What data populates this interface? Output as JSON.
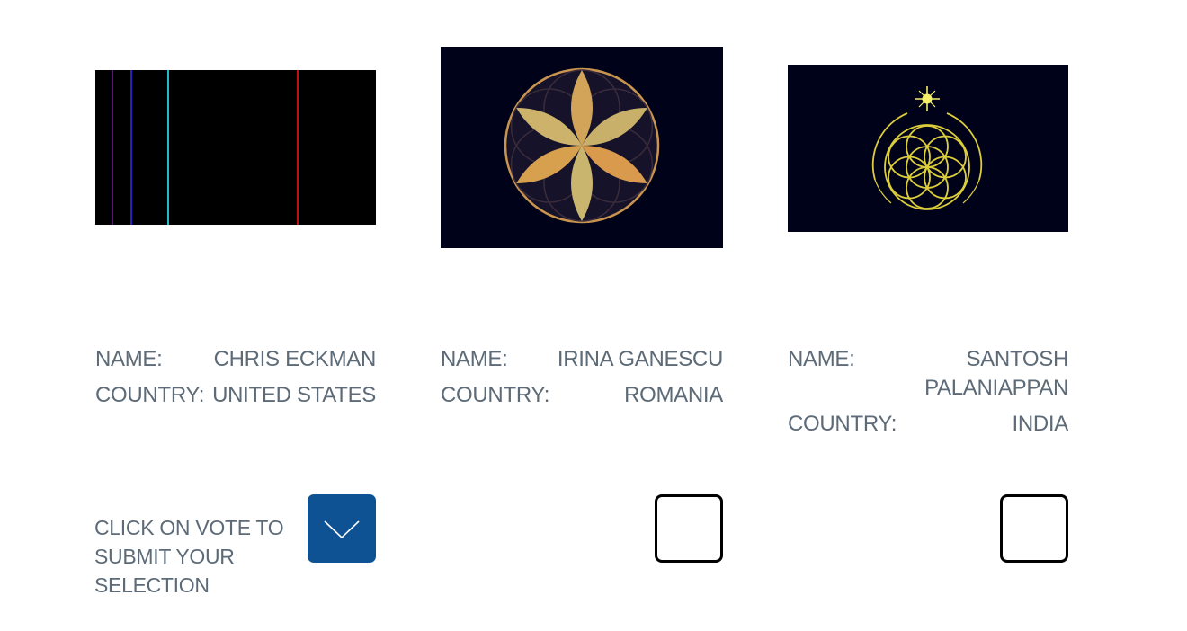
{
  "entries": [
    {
      "image_icon": "spectral-lines-image",
      "name_label": "NAME:",
      "name": "CHRIS ECKMAN",
      "country_label": "COUNTRY:",
      "country": "UNITED STATES",
      "selected": true
    },
    {
      "image_icon": "golden-flower-of-life-image",
      "name_label": "NAME:",
      "name": "IRINA GANESCU",
      "country_label": "COUNTRY:",
      "country": "ROMANIA",
      "selected": false
    },
    {
      "image_icon": "star-moon-flower-of-life-image",
      "name_label": "NAME:",
      "name": "SANTOSH PALANIAPPAN",
      "country_label": "COUNTRY:",
      "country": "INDIA",
      "selected": false
    }
  ],
  "instructions": "CLICK ON VOTE TO SUBMIT YOUR SELECTION",
  "colors": {
    "text": "#5d6b78",
    "checked_box": "#0e5294",
    "dark_navy": "#00021a",
    "gold": "#d4a55a",
    "yellow_line": "#e3d44a"
  }
}
